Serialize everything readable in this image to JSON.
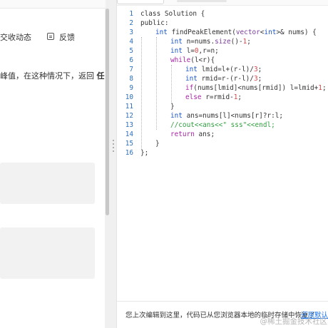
{
  "left_panel": {
    "action_submissions": "交收动态",
    "action_feedback": "反馈",
    "description_prefix": "峰值，在这种情况下，返回 ",
    "description_bold": "任"
  },
  "editor": {
    "lines": [
      {
        "n": "1",
        "indent": 0,
        "tokens": [
          {
            "t": "class Solution {",
            "c": "#333333"
          }
        ]
      },
      {
        "n": "2",
        "indent": 0,
        "tokens": [
          {
            "t": "public:",
            "c": "#333333"
          }
        ]
      },
      {
        "n": "3",
        "indent": 1,
        "tokens": [
          {
            "t": "int ",
            "c": "#1a56c9"
          },
          {
            "t": "findPeakElement(",
            "c": "#333333"
          },
          {
            "t": "vector",
            "c": "#7a3e9d"
          },
          {
            "t": "<",
            "c": "#333333"
          },
          {
            "t": "int",
            "c": "#1a56c9"
          },
          {
            "t": ">& nums) {",
            "c": "#333333"
          }
        ]
      },
      {
        "n": "4",
        "indent": 2,
        "tokens": [
          {
            "t": "int ",
            "c": "#1a56c9"
          },
          {
            "t": "n=nums.",
            "c": "#333333"
          },
          {
            "t": "size",
            "c": "#7a3e9d"
          },
          {
            "t": "()-",
            "c": "#333333"
          },
          {
            "t": "1",
            "c": "#d14848"
          },
          {
            "t": ";",
            "c": "#333333"
          }
        ]
      },
      {
        "n": "5",
        "indent": 2,
        "tokens": [
          {
            "t": "int ",
            "c": "#1a56c9"
          },
          {
            "t": "l=",
            "c": "#333333"
          },
          {
            "t": "0",
            "c": "#d14848"
          },
          {
            "t": ",r=n;",
            "c": "#333333"
          }
        ]
      },
      {
        "n": "6",
        "indent": 2,
        "tokens": [
          {
            "t": "while",
            "c": "#a626a4"
          },
          {
            "t": "(l<r){",
            "c": "#333333"
          }
        ]
      },
      {
        "n": "7",
        "indent": 3,
        "tokens": [
          {
            "t": "int ",
            "c": "#1a56c9"
          },
          {
            "t": "lmid=l+(r-l)/",
            "c": "#333333"
          },
          {
            "t": "3",
            "c": "#d14848"
          },
          {
            "t": ";",
            "c": "#333333"
          }
        ]
      },
      {
        "n": "8",
        "indent": 3,
        "tokens": [
          {
            "t": "int ",
            "c": "#1a56c9"
          },
          {
            "t": "rmid=r-(r-l)/",
            "c": "#333333"
          },
          {
            "t": "3",
            "c": "#d14848"
          },
          {
            "t": ";",
            "c": "#333333"
          }
        ]
      },
      {
        "n": "9",
        "indent": 3,
        "tokens": [
          {
            "t": "if",
            "c": "#a626a4"
          },
          {
            "t": "(nums[lmid]<nums[rmid]) l=lmid+",
            "c": "#333333"
          },
          {
            "t": "1",
            "c": "#d14848"
          },
          {
            "t": ";",
            "c": "#333333"
          }
        ]
      },
      {
        "n": "10",
        "indent": 3,
        "tokens": [
          {
            "t": "else ",
            "c": "#a626a4"
          },
          {
            "t": "r=rmid-",
            "c": "#333333"
          },
          {
            "t": "1",
            "c": "#d14848"
          },
          {
            "t": ";",
            "c": "#333333"
          }
        ]
      },
      {
        "n": "11",
        "indent": 2,
        "tokens": [
          {
            "t": "}",
            "c": "#333333"
          }
        ]
      },
      {
        "n": "12",
        "indent": 2,
        "tokens": [
          {
            "t": "int ",
            "c": "#1a56c9"
          },
          {
            "t": "ans=nums[l]<nums[r]?r:l;",
            "c": "#333333"
          }
        ]
      },
      {
        "n": "13",
        "indent": 2,
        "tokens": [
          {
            "t": "//cout<<ans<<\" sss\"<<endl;",
            "c": "#2e9e3e"
          }
        ]
      },
      {
        "n": "14",
        "indent": 2,
        "tokens": [
          {
            "t": "return ",
            "c": "#a626a4"
          },
          {
            "t": "ans;",
            "c": "#333333"
          }
        ]
      },
      {
        "n": "15",
        "indent": 1,
        "tokens": [
          {
            "t": "}",
            "c": "#333333"
          }
        ]
      },
      {
        "n": "16",
        "indent": 0,
        "tokens": [
          {
            "t": "};",
            "c": "#333333"
          }
        ]
      }
    ]
  },
  "status": {
    "restore_message": "您上次编辑到这里，代码已从您浏览器本地的临时存储中恢复了",
    "restore_link": "还原默认代",
    "watermark": "@稀土掘金技术社区"
  },
  "colors": {
    "line_number": "#2e6fb7",
    "keyword": "#a626a4",
    "type": "#1a56c9",
    "number": "#d14848",
    "comment": "#2e9e3e",
    "link": "#1a73e8"
  }
}
